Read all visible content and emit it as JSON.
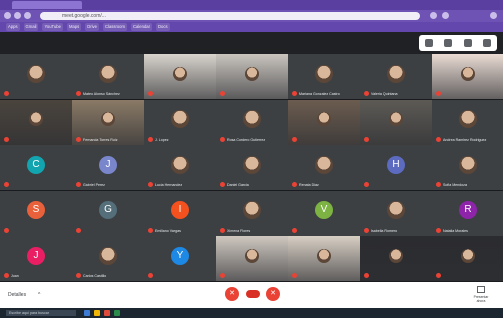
{
  "browser": {
    "url": "meet.google.com/..."
  },
  "bookmarks": [
    {
      "label": "Apps"
    },
    {
      "label": "Gmail"
    },
    {
      "label": "YouTube"
    },
    {
      "label": "Maps"
    },
    {
      "label": "Drive"
    },
    {
      "label": "Classroom"
    },
    {
      "label": "Calendar"
    },
    {
      "label": "Docs"
    }
  ],
  "tiles": [
    {
      "name": "",
      "initial": "",
      "kind": "photo",
      "color": "#3c4043"
    },
    {
      "name": "Mateo Alonso Sánchez",
      "initial": "",
      "kind": "photo",
      "color": "#3c4043"
    },
    {
      "name": "",
      "initial": "",
      "kind": "video",
      "color": "#d8d3cc"
    },
    {
      "name": "",
      "initial": "",
      "kind": "video",
      "color": "#c9c4be"
    },
    {
      "name": "Mariana Gonzalez Castro",
      "initial": "",
      "kind": "photo",
      "color": "#3c4043"
    },
    {
      "name": "Valeria Quintana",
      "initial": "",
      "kind": "photo",
      "color": "#3c4043"
    },
    {
      "name": "",
      "initial": "",
      "kind": "video",
      "color": "#e9dbd3"
    },
    {
      "name": "",
      "initial": "",
      "kind": "video",
      "color": "#4a443d"
    },
    {
      "name": "Fernanda Torres Ruiz",
      "initial": "",
      "kind": "video",
      "color": "#8a7a66"
    },
    {
      "name": "J. Lopez",
      "initial": "",
      "kind": "photo",
      "color": "#3c4043"
    },
    {
      "name": "Rosa Cordero Gutierrez",
      "initial": "",
      "kind": "photo",
      "color": "#3c4043"
    },
    {
      "name": "",
      "initial": "",
      "kind": "video",
      "color": "#6b5c4f"
    },
    {
      "name": "",
      "initial": "",
      "kind": "video",
      "color": "#5d5a55"
    },
    {
      "name": "Andrea Ramirez Rodriguez",
      "initial": "",
      "kind": "photo",
      "color": "#3c4043"
    },
    {
      "name": "",
      "initial": "C",
      "kind": "letter",
      "color": "#12a4af"
    },
    {
      "name": "Gabriel Perez",
      "initial": "J",
      "kind": "letter",
      "color": "#7986cb"
    },
    {
      "name": "Lucia Hernandez",
      "initial": "",
      "kind": "photo",
      "color": "#3c4043"
    },
    {
      "name": "Daniel Garcia",
      "initial": "",
      "kind": "photo",
      "color": "#3c4043"
    },
    {
      "name": "Renata Diaz",
      "initial": "",
      "kind": "photo",
      "color": "#3c4043"
    },
    {
      "name": "",
      "initial": "H",
      "kind": "letter",
      "color": "#5c6bc0"
    },
    {
      "name": "Sofia Mendoza",
      "initial": "",
      "kind": "photo",
      "color": "#3c4043"
    },
    {
      "name": "",
      "initial": "S",
      "kind": "letter",
      "color": "#e8613a"
    },
    {
      "name": "",
      "initial": "G",
      "kind": "letter",
      "color": "#546e7a"
    },
    {
      "name": "Emiliano Vargas",
      "initial": "I",
      "kind": "letter",
      "color": "#f4511e"
    },
    {
      "name": "Ximena Flores",
      "initial": "",
      "kind": "photo",
      "color": "#3c4043"
    },
    {
      "name": "",
      "initial": "V",
      "kind": "letter",
      "color": "#7cb342"
    },
    {
      "name": "Isabella Romero",
      "initial": "",
      "kind": "photo",
      "color": "#3c4043"
    },
    {
      "name": "Natalia Morales",
      "initial": "R",
      "kind": "letter",
      "color": "#8e24aa"
    },
    {
      "name": "Juan",
      "initial": "J",
      "kind": "letter",
      "color": "#e91e63"
    },
    {
      "name": "Carlos Castillo",
      "initial": "",
      "kind": "photo",
      "color": "#3c4043"
    },
    {
      "name": "",
      "initial": "Y",
      "kind": "letter",
      "color": "#1e88e5"
    },
    {
      "name": "",
      "initial": "",
      "kind": "video",
      "color": "#cfc8c0"
    },
    {
      "name": "",
      "initial": "",
      "kind": "video",
      "color": "#d8cfc4"
    },
    {
      "name": "",
      "initial": "",
      "kind": "video",
      "color": "#2b2c2f"
    },
    {
      "name": "",
      "initial": "",
      "kind": "video",
      "color": "#2b2c2f"
    }
  ],
  "meeting": {
    "details_label": "Detalles",
    "chevron": "^",
    "present_label": "Presentar ahora",
    "mic_icon": "mic-off-icon",
    "cam_icon": "camera-off-icon"
  },
  "taskbar": {
    "search_placeholder": "Escribe aquí para buscar"
  },
  "colors": {
    "browser_chrome": "#5a3fa0",
    "meet_background": "#202124",
    "danger": "#ea4335"
  }
}
